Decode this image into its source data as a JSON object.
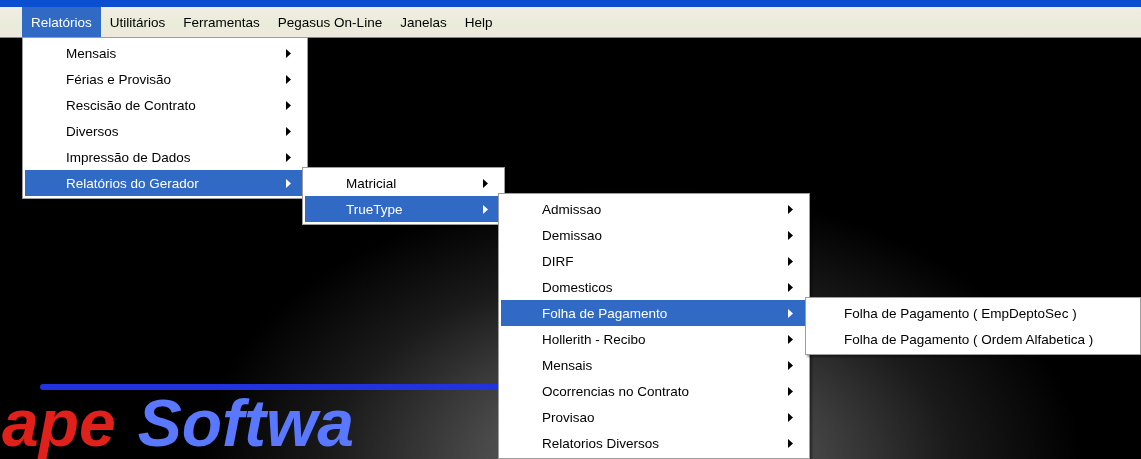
{
  "menu_bar": [
    {
      "label": "Relatórios",
      "selected": true
    },
    {
      "label": "Utilitários",
      "selected": false
    },
    {
      "label": "Ferramentas",
      "selected": false
    },
    {
      "label": "Pegasus On-Line",
      "selected": false
    },
    {
      "label": "Janelas",
      "selected": false
    },
    {
      "label": "Help",
      "selected": false
    }
  ],
  "menus": [
    {
      "items": [
        {
          "label": "Mensais",
          "has_submenu": true,
          "selected": false
        },
        {
          "label": "Férias e Provisão",
          "has_submenu": true,
          "selected": false
        },
        {
          "label": "Rescisão de Contrato",
          "has_submenu": true,
          "selected": false
        },
        {
          "label": "Diversos",
          "has_submenu": true,
          "selected": false
        },
        {
          "label": "Impressão de Dados",
          "has_submenu": true,
          "selected": false
        },
        {
          "label": "Relatórios do Gerador",
          "has_submenu": true,
          "selected": true
        }
      ]
    },
    {
      "items": [
        {
          "label": "Matricial",
          "has_submenu": true,
          "selected": false
        },
        {
          "label": "TrueType",
          "has_submenu": true,
          "selected": true
        }
      ]
    },
    {
      "items": [
        {
          "label": "Admissao",
          "has_submenu": true,
          "selected": false
        },
        {
          "label": "Demissao",
          "has_submenu": true,
          "selected": false
        },
        {
          "label": "DIRF",
          "has_submenu": true,
          "selected": false
        },
        {
          "label": "Domesticos",
          "has_submenu": true,
          "selected": false
        },
        {
          "label": "Folha de Pagamento",
          "has_submenu": true,
          "selected": true
        },
        {
          "label": "Hollerith - Recibo",
          "has_submenu": true,
          "selected": false
        },
        {
          "label": "Mensais",
          "has_submenu": true,
          "selected": false
        },
        {
          "label": "Ocorrencias no Contrato",
          "has_submenu": true,
          "selected": false
        },
        {
          "label": "Provisao",
          "has_submenu": true,
          "selected": false
        },
        {
          "label": "Relatorios Diversos",
          "has_submenu": true,
          "selected": false
        }
      ]
    },
    {
      "items": [
        {
          "label": "Folha de Pagamento ( EmpDeptoSec )",
          "has_submenu": false,
          "selected": false
        },
        {
          "label": "Folha de Pagamento ( Ordem Alfabetica )",
          "has_submenu": false,
          "selected": false
        }
      ]
    }
  ],
  "logo": {
    "part_1": "ape",
    "part_2": "Softwa"
  }
}
